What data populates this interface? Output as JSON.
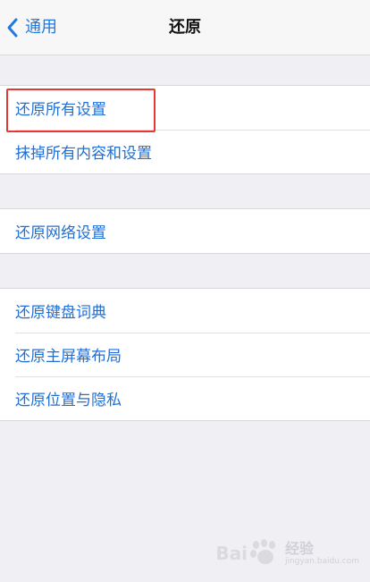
{
  "navbar": {
    "back_label": "通用",
    "title": "还原"
  },
  "groups": [
    {
      "items": [
        {
          "label": "还原所有设置",
          "highlighted": true
        },
        {
          "label": "抹掉所有内容和设置"
        }
      ]
    },
    {
      "items": [
        {
          "label": "还原网络设置"
        }
      ]
    },
    {
      "items": [
        {
          "label": "还原键盘词典"
        },
        {
          "label": "还原主屏幕布局"
        },
        {
          "label": "还原位置与隐私"
        }
      ]
    }
  ],
  "colors": {
    "accent": "#1f6fd6",
    "highlight": "#e53935",
    "background": "#efeff4"
  },
  "watermark": {
    "brand": "Bai",
    "text": "经验",
    "url": "jingyan.baidu.com"
  }
}
